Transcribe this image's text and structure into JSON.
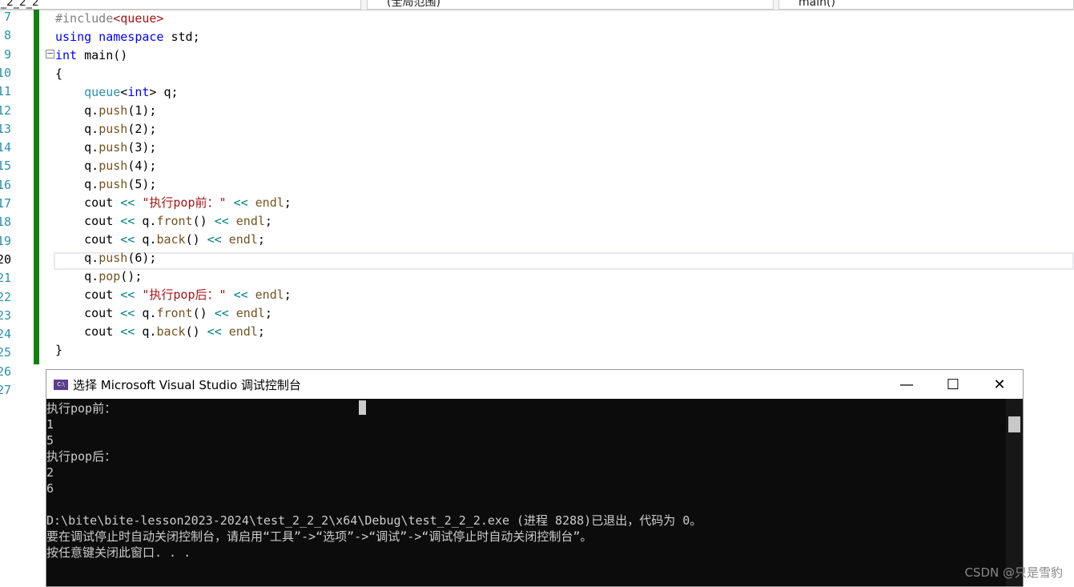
{
  "toolbar": {
    "project": "_2_2_2",
    "scope": "(全局范围)",
    "member": "main()"
  },
  "line_numbers": [
    "7",
    "8",
    "9",
    "10",
    "11",
    "12",
    "13",
    "14",
    "15",
    "16",
    "17",
    "18",
    "19",
    "20",
    "21",
    "22",
    "23",
    "24",
    "25",
    "26",
    "27"
  ],
  "console": {
    "title": "选择 Microsoft Visual Studio 调试控制台",
    "output": "执行pop前：\n1\n5\n执行pop后：\n2\n6\n\nD:\\bite\\bite-lesson2023-2024\\test_2_2_2\\x64\\Debug\\test_2_2_2.exe (进程 8288)已退出，代码为 0。\n要在调试停止时自动关闭控制台，请启用“工具”->“选项”->“调试”->“调试停止时自动关闭控制台”。\n按任意键关闭此窗口. . .",
    "minimize": "—",
    "maximize": "☐",
    "close": "✕"
  },
  "watermark": "CSDN @只是雪豹",
  "code": {
    "l1a": "#include",
    "l1b": "<queue>",
    "str1": "\"执行pop前：\"",
    "str2": "\"执行pop后：\""
  }
}
